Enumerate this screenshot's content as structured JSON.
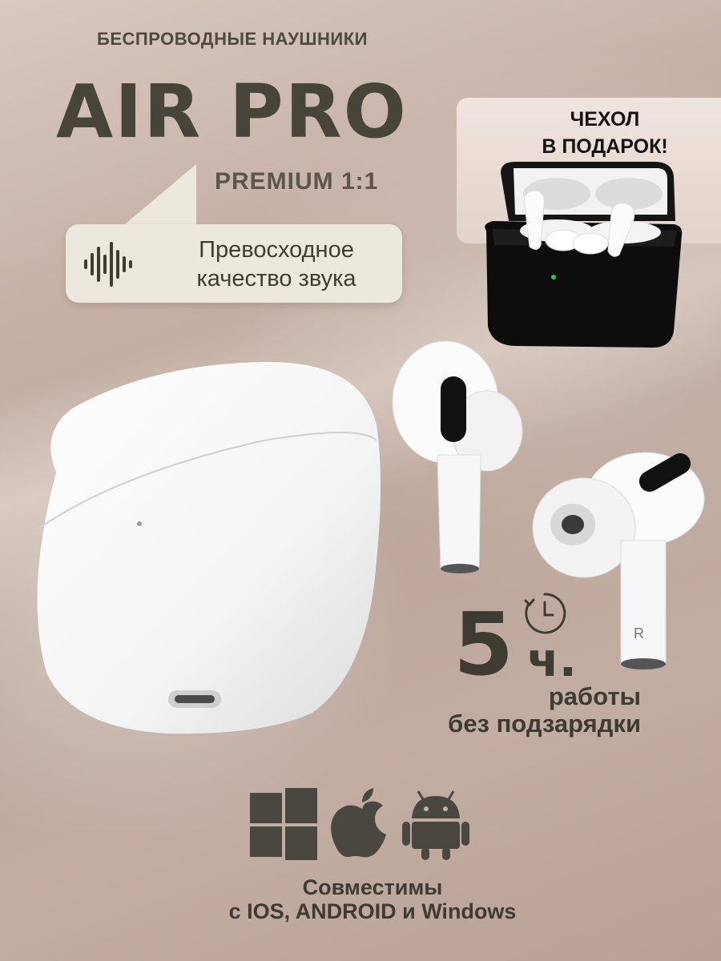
{
  "header": {
    "subtitle": "БЕСПРОВОДНЫЕ НАУШНИКИ",
    "title": "AIR PRO",
    "edition": "PREMIUM 1:1"
  },
  "feature_bubble": {
    "text_line1": "Превосходное",
    "text_line2": "качество звука",
    "icon": "sound-wave-icon"
  },
  "gift": {
    "line1": "ЧЕХОЛ",
    "line2": "В ПОДАРОК!"
  },
  "battery": {
    "hours": "5",
    "unit": "ч.",
    "line1": "работы",
    "line2": "без подзарядки",
    "icon": "timer-icon"
  },
  "compatibility": {
    "line1": "Совместимы",
    "line2": "с IOS, ANDROID и Windows",
    "icons": [
      "windows-icon",
      "apple-icon",
      "android-icon"
    ]
  },
  "earbud_marking": "R",
  "colors": {
    "text_dark": "#47443a",
    "bubble_bg": "#ece8de",
    "case_black": "#111111"
  }
}
